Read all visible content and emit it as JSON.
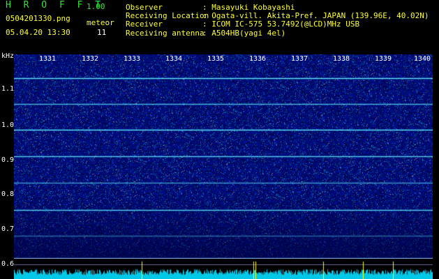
{
  "app": {
    "logo": "H R O F F T",
    "version": "1.00",
    "filename": "0504201330.png",
    "datetime": "05.04.20 13:30",
    "meteor_label": "meteor",
    "meteor_count": "11"
  },
  "info": [
    {
      "label": "Observer",
      "value": ": Masayuki Kobayashi"
    },
    {
      "label": "Receiving Location",
      "value": ": Ogata-vill. Akita-Pref. JAPAN (139.96E, 40.02N)"
    },
    {
      "label": "Receiver",
      "value": ": ICOM IC-575 53.7492(@LCD)MHz USB"
    },
    {
      "label": "Receiving antenna",
      "value": ": A504HB(yagi 4el)"
    }
  ],
  "axis": {
    "y_unit": "kHz",
    "y_ticks": [
      "1.1",
      "1.0",
      "0.9",
      "0.8",
      "0.7",
      "0.6"
    ],
    "x_ticks": [
      "1331",
      "1332",
      "1333",
      "1334",
      "1335",
      "1336",
      "1337",
      "1338",
      "1339",
      "1340"
    ]
  },
  "colors": {
    "background": "#000000",
    "waterfall_base": "#00107a",
    "signal": "#6ef0ff",
    "strip": "#00c8e6",
    "spike": "#ffff00"
  }
}
